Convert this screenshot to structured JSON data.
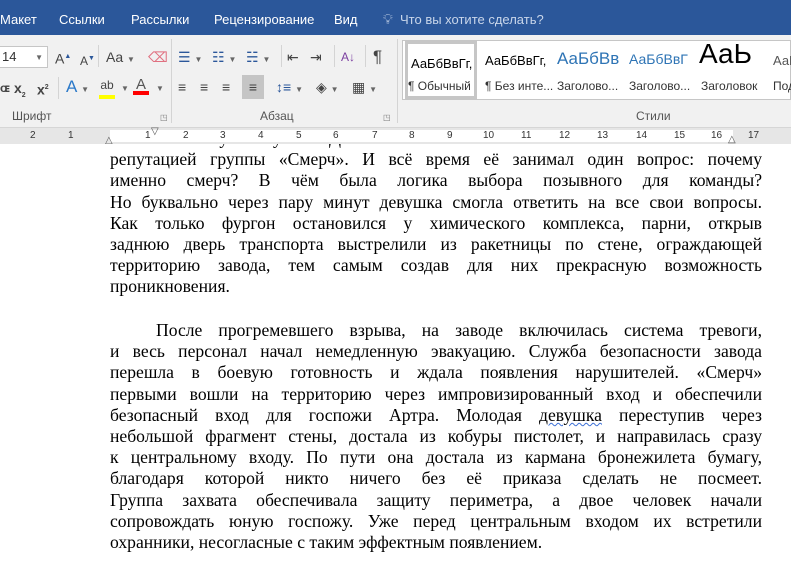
{
  "tabs": [
    "Макет",
    "Ссылки",
    "Рассылки",
    "Рецензирование",
    "Вид"
  ],
  "tell_me": "Что вы хотите сделать?",
  "font": {
    "size": "14",
    "group": "Шрифт"
  },
  "paragraph": {
    "group": "Абзац"
  },
  "styles": {
    "group": "Стили",
    "items": [
      {
        "preview": "АаБбВвГг,",
        "name": "¶ Обычный"
      },
      {
        "preview": "АаБбВвГг,",
        "name": "¶ Без инте..."
      },
      {
        "preview": "АаБбВв",
        "name": "Заголово..."
      },
      {
        "preview": "АаБбВвГ",
        "name": "Заголово..."
      },
      {
        "preview": "АаЬ",
        "name": "Заголовок"
      },
      {
        "preview": "АаБ",
        "name": "Под"
      }
    ]
  },
  "ruler": [
    "2",
    "1",
    "1",
    "2",
    "3",
    "4",
    "5",
    "6",
    "7",
    "8",
    "9",
    "10",
    "11",
    "12",
    "13",
    "14",
    "15",
    "16",
    "17"
  ],
  "colors": {
    "highlight": "#ffff00",
    "font_color": "#ff0000",
    "accent": "#2b579a"
  },
  "document": {
    "p1": [
      "Олівия усмехнулась. До этого момента она лишь была знакома только с",
      "репутацией группы «Смерч». И всё время её занимал один вопрос: почему",
      "именно смерч? В чём была логика выбора позывного для команды?",
      "Но буквально через пару минут девушка смогла ответить на все свои вопросы.",
      "Как только фургон остановился у химического комплекса, парни, открыв",
      "заднюю дверь транспорта выстрелили из ракетницы по стене, ограждающей",
      "территорию завода, тем самым создав для них прекрасную возможность",
      "проникновения."
    ],
    "p2": [
      "После прогремевшего взрыва, на заводе включилась система тревоги,",
      "и весь персонал начал немедленную эвакуацию. Служба безопасности завода",
      "перешла в боевую готовность и ждала появления нарушителей. «Смерч»",
      "первыми вошли на территорию через импровизированный вход и обеспечили",
      "безопасный вход для госпожи Артра. Молодая девушка переступив через",
      "небольшой фрагмент стены, достала из кобуры пистолет, и направилась сразу",
      "к центральному входу. По пути она достала из кармана бронежилета бумагу,",
      "благодаря которой никто ничего без её приказа сделать не посмеет.",
      "Группа захвата обеспечивала защиту периметра, а двое человек начали",
      "сопровождать юную госпожу. Уже перед центральным входом их встретили",
      "охранники, несогласные с таким эффектным появлением."
    ]
  }
}
